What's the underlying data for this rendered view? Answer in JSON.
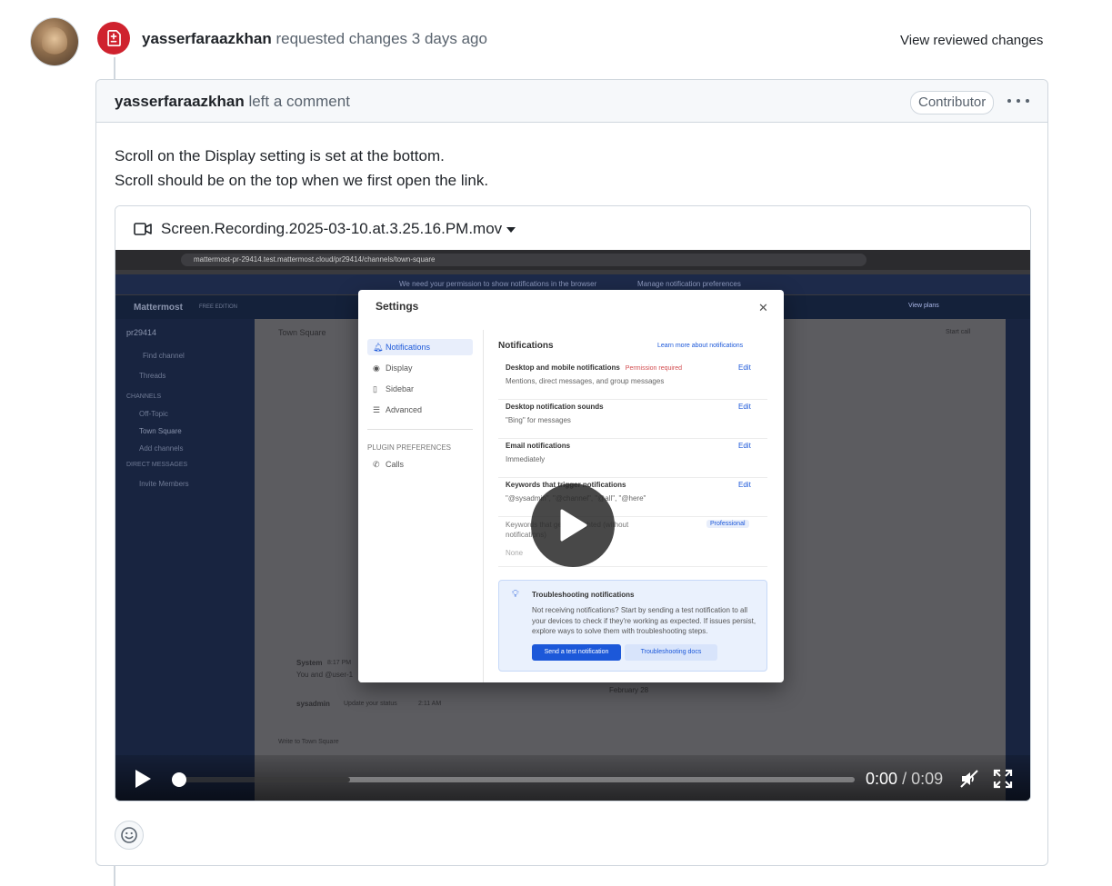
{
  "review": {
    "author": "yasserfaraazkhan",
    "action": "requested changes",
    "time": "3 days ago",
    "view_changes_label": "View reviewed changes"
  },
  "comment": {
    "author": "yasserfaraazkhan",
    "action": "left a comment",
    "role_badge": "Contributor",
    "body": [
      "Scroll on the Display setting is set at the bottom.",
      "Scroll should be on the top when we first open the link."
    ]
  },
  "attachment": {
    "filename": "Screen.Recording.2025-03-10.at.3.25.16.PM.mov"
  },
  "video": {
    "current_time": "0:00",
    "separator": "/",
    "duration": "0:09",
    "progress": 0,
    "frame": {
      "url": "mattermost-pr-29414.test.mattermost.cloud/pr29414/channels/town-square",
      "notice": "We need your permission to show notifications in the browser",
      "notice_button": "Manage notification preferences",
      "brand": "Mattermost",
      "edition": "FREE EDITION",
      "team": "pr29414",
      "find_channel": "Find channel",
      "threads": "Threads",
      "channels_header": "CHANNELS",
      "channels": [
        "Off-Topic",
        "Town Square"
      ],
      "add_channels": "Add channels",
      "dm_header": "DIRECT MESSAGES",
      "invite": "Invite Members",
      "channel_title": "Town Square",
      "start_call": "Start call",
      "view_plans": "View plans",
      "settings_title": "Settings",
      "nav": [
        "Notifications",
        "Display",
        "Sidebar",
        "Advanced"
      ],
      "plugin_header": "PLUGIN PREFERENCES",
      "plugin_item": "Calls",
      "content_title": "Notifications",
      "learn_more": "Learn more about notifications",
      "edit_label": "Edit",
      "permission_label": "Permission required",
      "professional_label": "Professional",
      "settings": [
        {
          "title": "Desktop and mobile notifications",
          "desc": "Mentions, direct messages, and group messages"
        },
        {
          "title": "Desktop notification sounds",
          "desc": "\"Bing\" for messages"
        },
        {
          "title": "Email notifications",
          "desc": "Immediately"
        },
        {
          "title": "Keywords that trigger notifications",
          "desc": "\"@sysadmin\", \"@channel\", \"@all\", \"@here\""
        },
        {
          "title": "Keywords that get highlighted (without notifications)",
          "desc": "None"
        }
      ],
      "trouble_title": "Troubleshooting notifications",
      "trouble_desc": "Not receiving notifications? Start by sending a test notification to all your devices to check if they're working as expected. If issues persist, explore ways to solve them with troubleshooting steps.",
      "trouble_btn1": "Send a test notification",
      "trouble_btn2": "Troubleshooting docs",
      "system_name": "System",
      "system_time": "8:17 PM",
      "system_msg": "You and @user-1",
      "date_divider": "February 28",
      "user_name": "sysadmin",
      "user_status": "Update your status",
      "user_time": "2:11 AM",
      "input_placeholder": "Write to Town Square"
    }
  }
}
